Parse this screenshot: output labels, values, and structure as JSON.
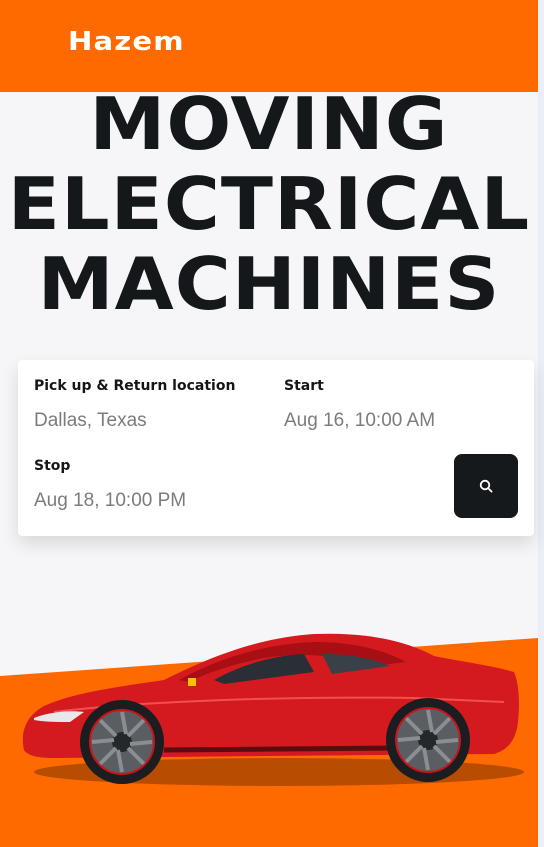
{
  "header": {
    "logo_text": "Hazem",
    "background_color": "#ff6a00"
  },
  "hero": {
    "lines": [
      "MOVING",
      "ELECTRICAL",
      "MACHINES"
    ]
  },
  "booking": {
    "location_label": "Pick up & Return location",
    "location_value": "Dallas, Texas",
    "start_label": "Start",
    "start_value": "Aug 16, 10:00 AM",
    "stop_label": "Stop",
    "stop_value": "Aug 18, 10:00 PM",
    "search_icon": "search-icon"
  },
  "colors": {
    "accent": "#ff6a00",
    "dark": "#16191c",
    "car_red": "#d41a1f"
  }
}
